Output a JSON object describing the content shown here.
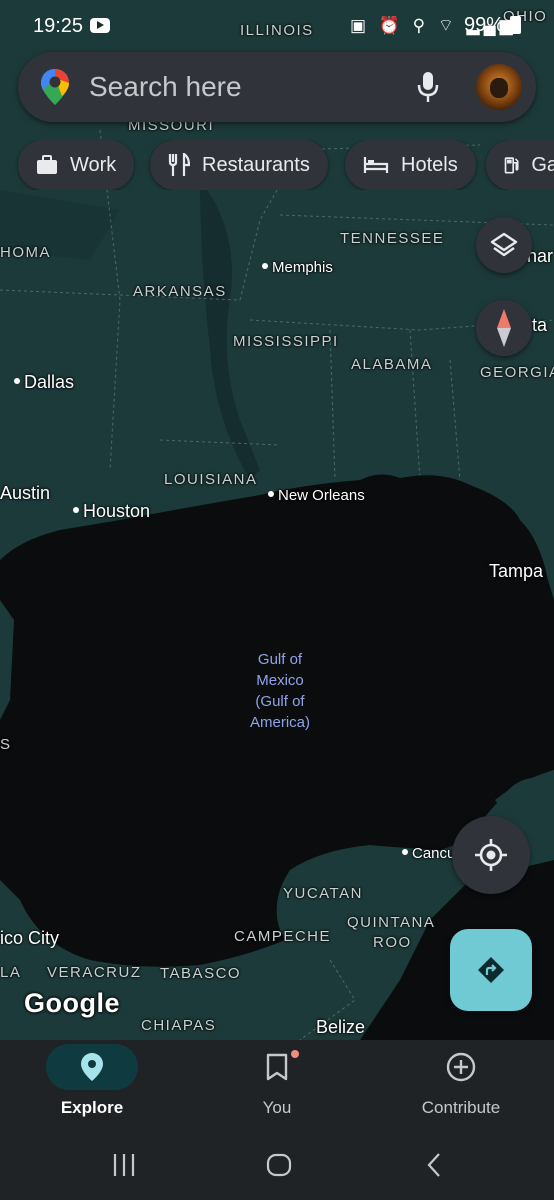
{
  "status_bar": {
    "time": "19:25",
    "icons": "▣ ⏰ ⚲ ⌔ ▂▄▆",
    "battery": "99%"
  },
  "search": {
    "placeholder": "Search here",
    "icons": [
      "maps-pin-icon",
      "mic-icon",
      "avatar"
    ]
  },
  "chips": [
    {
      "label": "Work",
      "icon": "briefcase-icon"
    },
    {
      "label": "Restaurants",
      "icon": "fork-knife-icon"
    },
    {
      "label": "Hotels",
      "icon": "bed-icon"
    },
    {
      "label": "Ga",
      "icon": "gas-station-icon"
    }
  ],
  "map": {
    "states": {
      "illinois": "ILLINOIS",
      "ohio": "OHIO",
      "missouri": "MISSOURI",
      "oklahoma": "HOMA",
      "tennessee": "TENNESSEE",
      "arkansas": "ARKANSAS",
      "mississippi": "MISSISSIPPI",
      "alabama": "ALABAMA",
      "georgia": "GEORGIA",
      "louisiana": "LOUISIANA",
      "yucatan": "YUCATAN",
      "quintana_roo_1": "QUINTANA",
      "quintana_roo_2": "ROO",
      "campeche": "CAMPECHE",
      "veracruz": "VERACRUZ",
      "tabasco": "TABASCO",
      "chiapas": "CHIAPAS",
      "la": "LA",
      "s": "S"
    },
    "cities": {
      "memphis": "Memphis",
      "dallas": "Dallas",
      "austin": "Austin",
      "houston": "Houston",
      "new_orleans": "New Orleans",
      "tampa": "Tampa",
      "cancun": "Cancu",
      "mexico_city": "ico City",
      "belize": "Belize",
      "nashville_partial": "har",
      "atlanta_partial": "ta"
    },
    "water": [
      "Gulf of",
      "Mexico",
      "(Gulf of",
      "America)"
    ],
    "attribution": "Google"
  },
  "bottom_nav": [
    {
      "label": "Explore",
      "icon": "location-pin-icon",
      "active": true
    },
    {
      "label": "You",
      "icon": "bookmark-icon",
      "active": false,
      "has_notification": true
    },
    {
      "label": "Contribute",
      "icon": "add-circle-icon",
      "active": false
    }
  ],
  "colors": {
    "land": "#1d3a3a",
    "water": "#0b0c0e",
    "surface": "#30343a",
    "nav_bg": "#1f2326",
    "accent": "#6fcad3",
    "active_pill": "#0f3a3f",
    "water_label": "#8fa4e8"
  }
}
